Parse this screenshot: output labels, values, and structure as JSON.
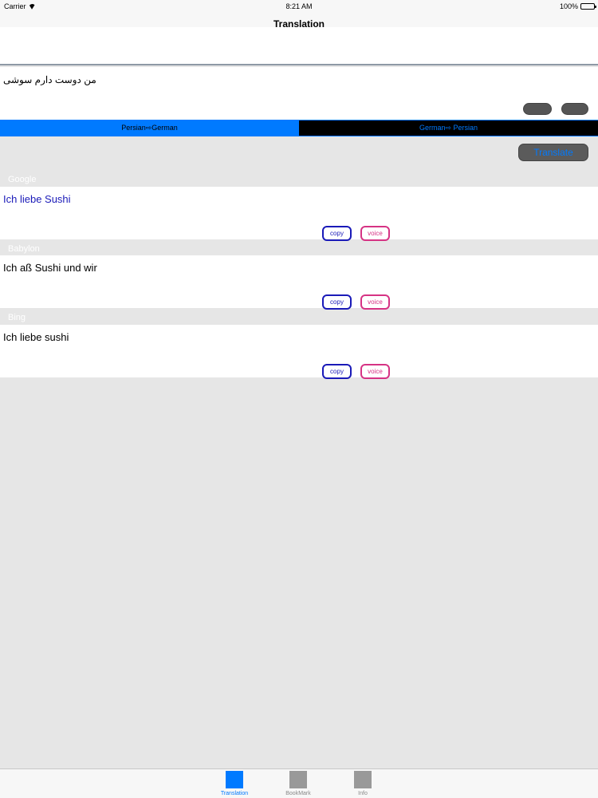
{
  "status_bar": {
    "carrier": "Carrier",
    "time": "8:21 AM",
    "battery": "100%",
    "battery_level": 1.0
  },
  "nav": {
    "title": "Translation"
  },
  "input": {
    "source_text": "من دوست دارم سوشی",
    "clear_label": "",
    "paste_label": ""
  },
  "direction": {
    "options": [
      "Persian⇨German",
      "German⇨ Persian"
    ],
    "selected": "Persian⇨German"
  },
  "translate_button": "Translate",
  "results": [
    {
      "engine": "Google",
      "text": "Ich liebe Sushi",
      "copy_label": "copy",
      "voice_label": "voice"
    },
    {
      "engine": "Babylon",
      "text": "Ich aß Sushi und wir",
      "copy_label": "copy",
      "voice_label": "voice"
    },
    {
      "engine": "Bing",
      "text": "Ich liebe sushi",
      "copy_label": "copy",
      "voice_label": "voice"
    }
  ],
  "tabs": [
    {
      "label": "Translation",
      "icon": "translation-icon",
      "active": true
    },
    {
      "label": "BookMark",
      "icon": "bookmark-icon",
      "active": false
    },
    {
      "label": "Info",
      "icon": "info-icon",
      "active": false
    }
  ],
  "colors": {
    "accent": "#007aff",
    "copy": "#1a1ab8",
    "voice": "#d63384"
  }
}
